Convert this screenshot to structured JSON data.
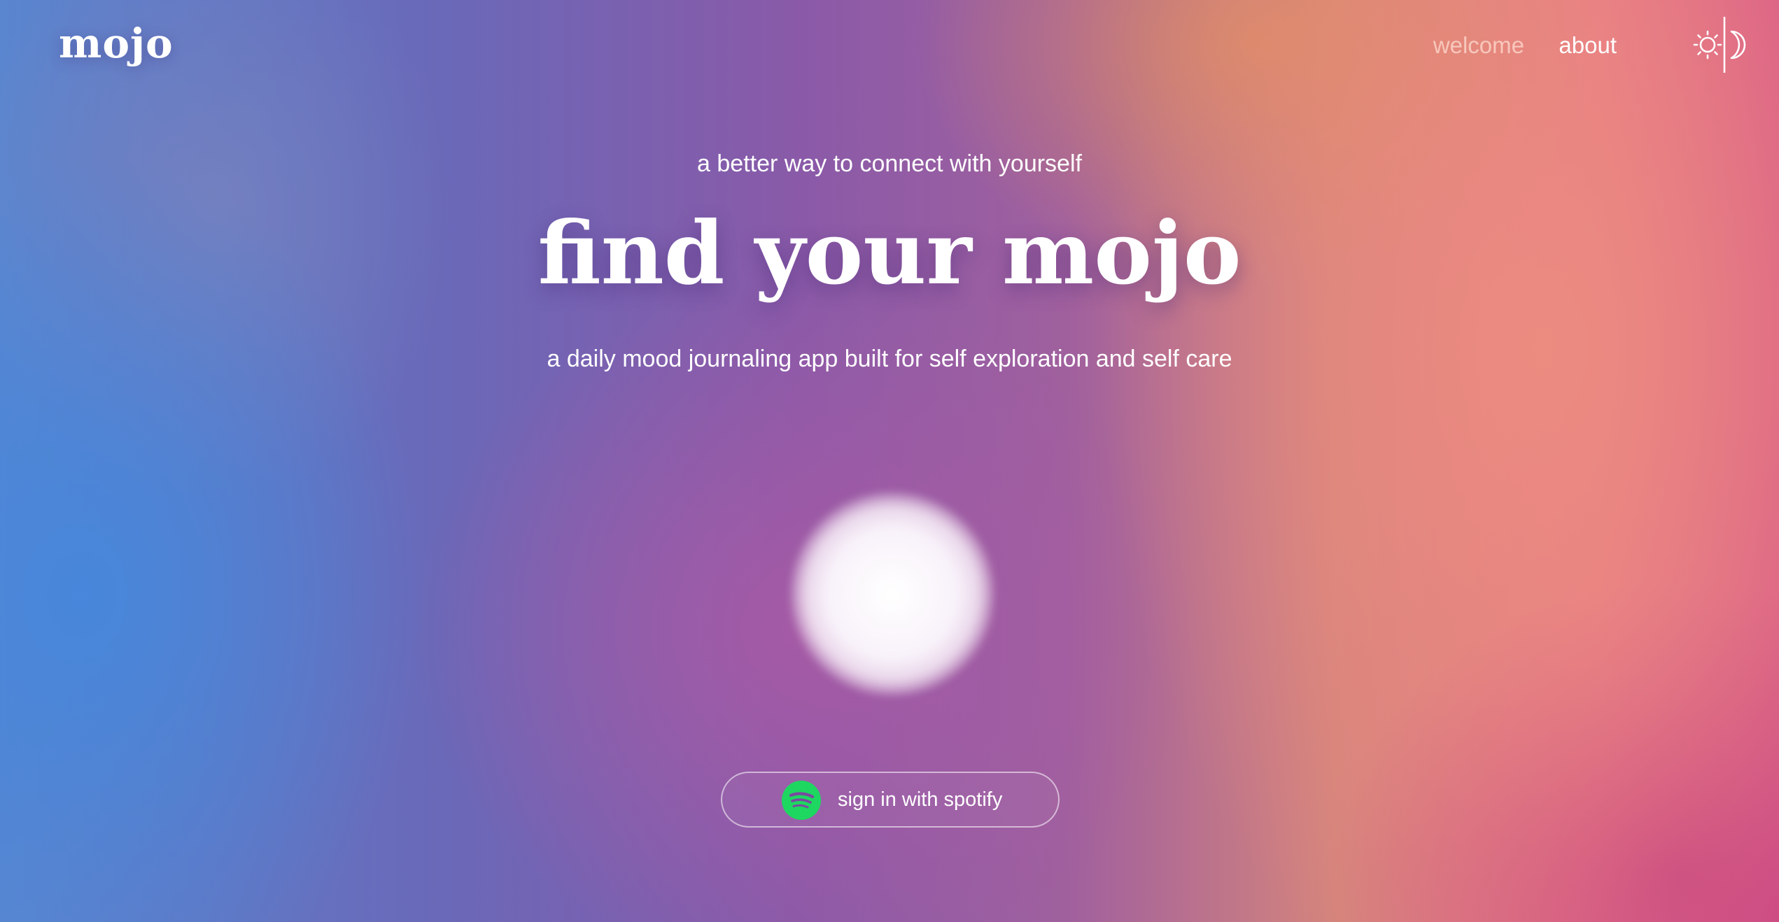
{
  "header": {
    "brand": "mojo",
    "nav": {
      "welcome": "welcome",
      "about": "about"
    },
    "theme_toggle_icons": [
      "sun-icon",
      "moon-icon"
    ]
  },
  "hero": {
    "tagline": "a better way to connect with yourself",
    "title": "find your mojo",
    "subtitle": "a daily mood journaling app built for self exploration and self care"
  },
  "signin": {
    "label": "sign in with spotify",
    "icon": "spotify-icon",
    "icon_color": "#1ed760"
  },
  "colors": {
    "text": "#ffffff",
    "welcome_link": "#ffdcd2"
  }
}
